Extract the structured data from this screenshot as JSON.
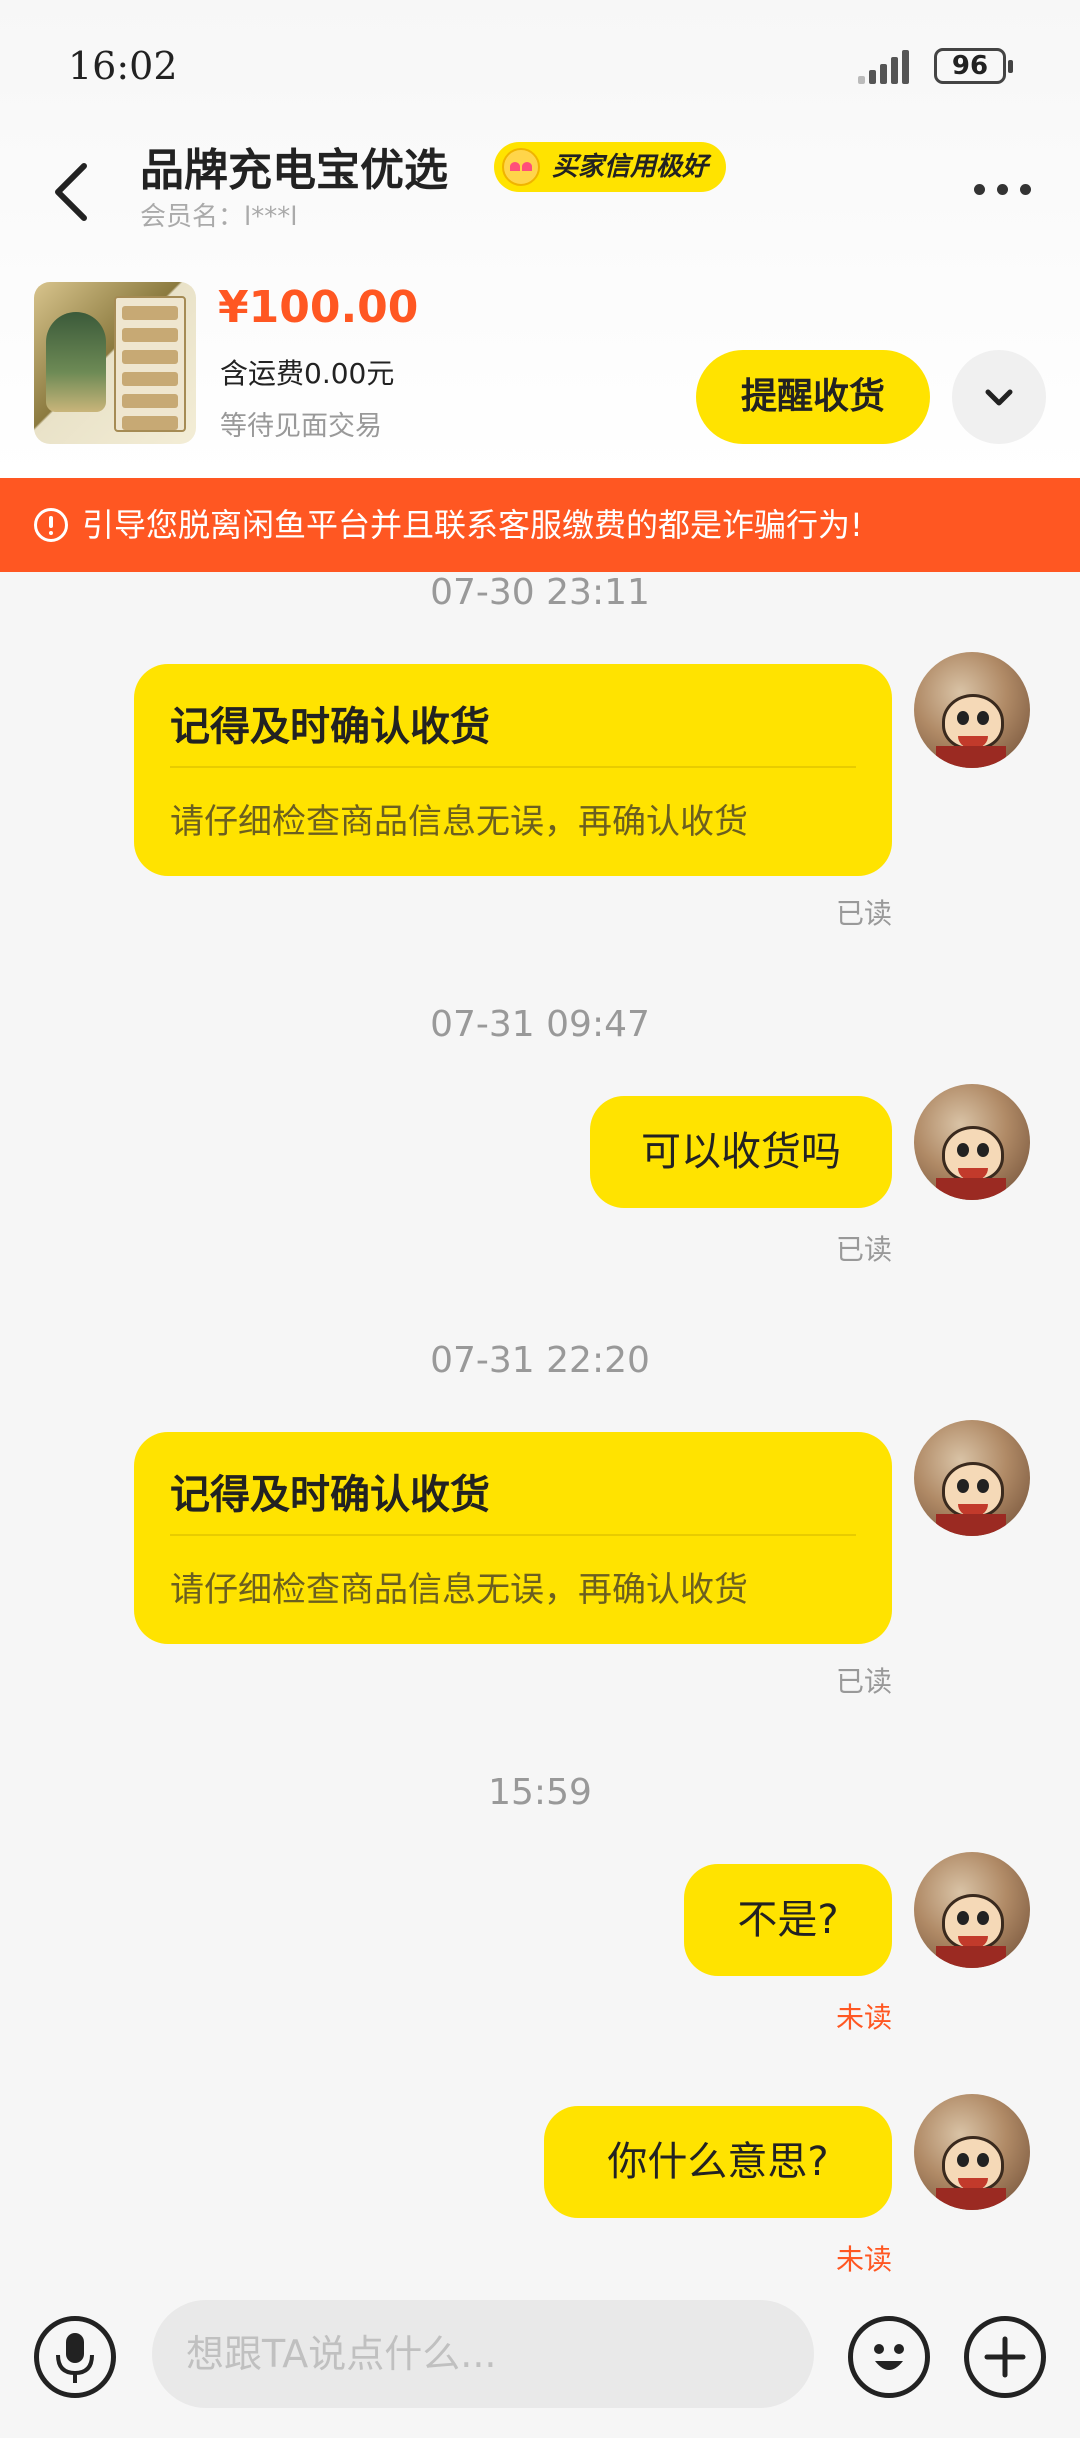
{
  "status_bar": {
    "time": "16:02",
    "battery": "96",
    "icons": [
      "signal-icon",
      "battery-icon"
    ]
  },
  "header": {
    "back_icon": "back-arrow-icon",
    "title": "品牌充电宝优选",
    "credit_badge": "买家信用极好",
    "member_label": "会员名：l***l",
    "more_icon": "more-dots-icon"
  },
  "product": {
    "price": "¥100.00",
    "shipping": "含运费0.00元",
    "status": "等待见面交易",
    "remind_button": "提醒收货",
    "expand_icon": "chevron-down-icon"
  },
  "warning": {
    "icon": "alert-icon",
    "text": "引导您脱离闲鱼平台并且联系客服缴费的都是诈骗行为!"
  },
  "messages": [
    {
      "timestamp": "07-30 23:11",
      "type": "card",
      "title": "记得及时确认收货",
      "body": "请仔细检查商品信息无误，再确认收货",
      "status": "已读"
    },
    {
      "timestamp": "07-31 09:47",
      "type": "text",
      "text": "可以收货吗",
      "status": "已读"
    },
    {
      "timestamp": "07-31 22:20",
      "type": "card",
      "title": "记得及时确认收货",
      "body": "请仔细检查商品信息无误，再确认收货",
      "status": "已读"
    },
    {
      "timestamp": "15:59",
      "type": "text",
      "text": "不是?",
      "status": "未读"
    },
    {
      "type": "text",
      "text": "你什么意思?",
      "status": "未读"
    }
  ],
  "input_bar": {
    "placeholder": "想跟TA说点什么...",
    "icons": [
      "microphone-icon",
      "emoji-icon",
      "plus-icon"
    ]
  },
  "colors": {
    "accent_yellow": "#ffe300",
    "warning_orange": "#ff5722",
    "unread_red": "#ff5722"
  }
}
